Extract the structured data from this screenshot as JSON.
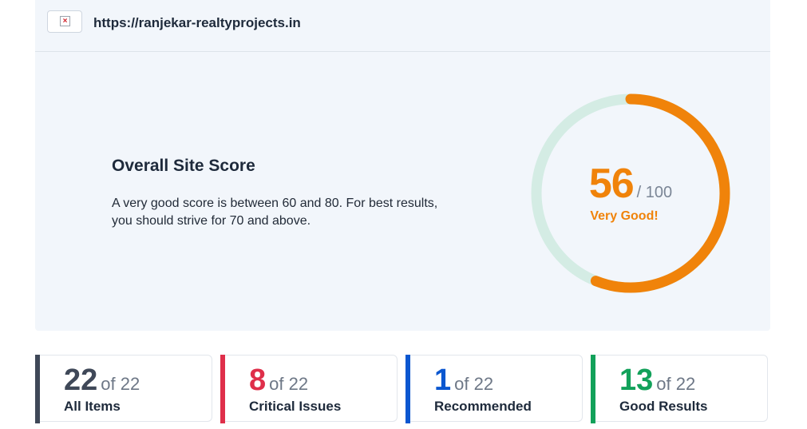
{
  "site": {
    "url": "https://ranjekar-realtyprojects.in",
    "favicon_icon": "broken-image-icon"
  },
  "score": {
    "title": "Overall Site Score",
    "description": "A very good score is between 60 and 80. For best results, you should strive for 70 and above.",
    "value": "56",
    "max_label": "/ 100",
    "grade": "Very Good!",
    "fraction": 0.56,
    "colors": {
      "progress": "#f0830a",
      "track": "#d4ece4"
    }
  },
  "stats": [
    {
      "count": "22",
      "of": "of 22",
      "label": "All Items",
      "color": "#3f4858"
    },
    {
      "count": "8",
      "of": "of 22",
      "label": "Critical Issues",
      "color": "#df2f4a"
    },
    {
      "count": "1",
      "of": "of 22",
      "label": "Recommended",
      "color": "#0b57d0"
    },
    {
      "count": "13",
      "of": "of 22",
      "label": "Good Results",
      "color": "#12a15a"
    }
  ]
}
